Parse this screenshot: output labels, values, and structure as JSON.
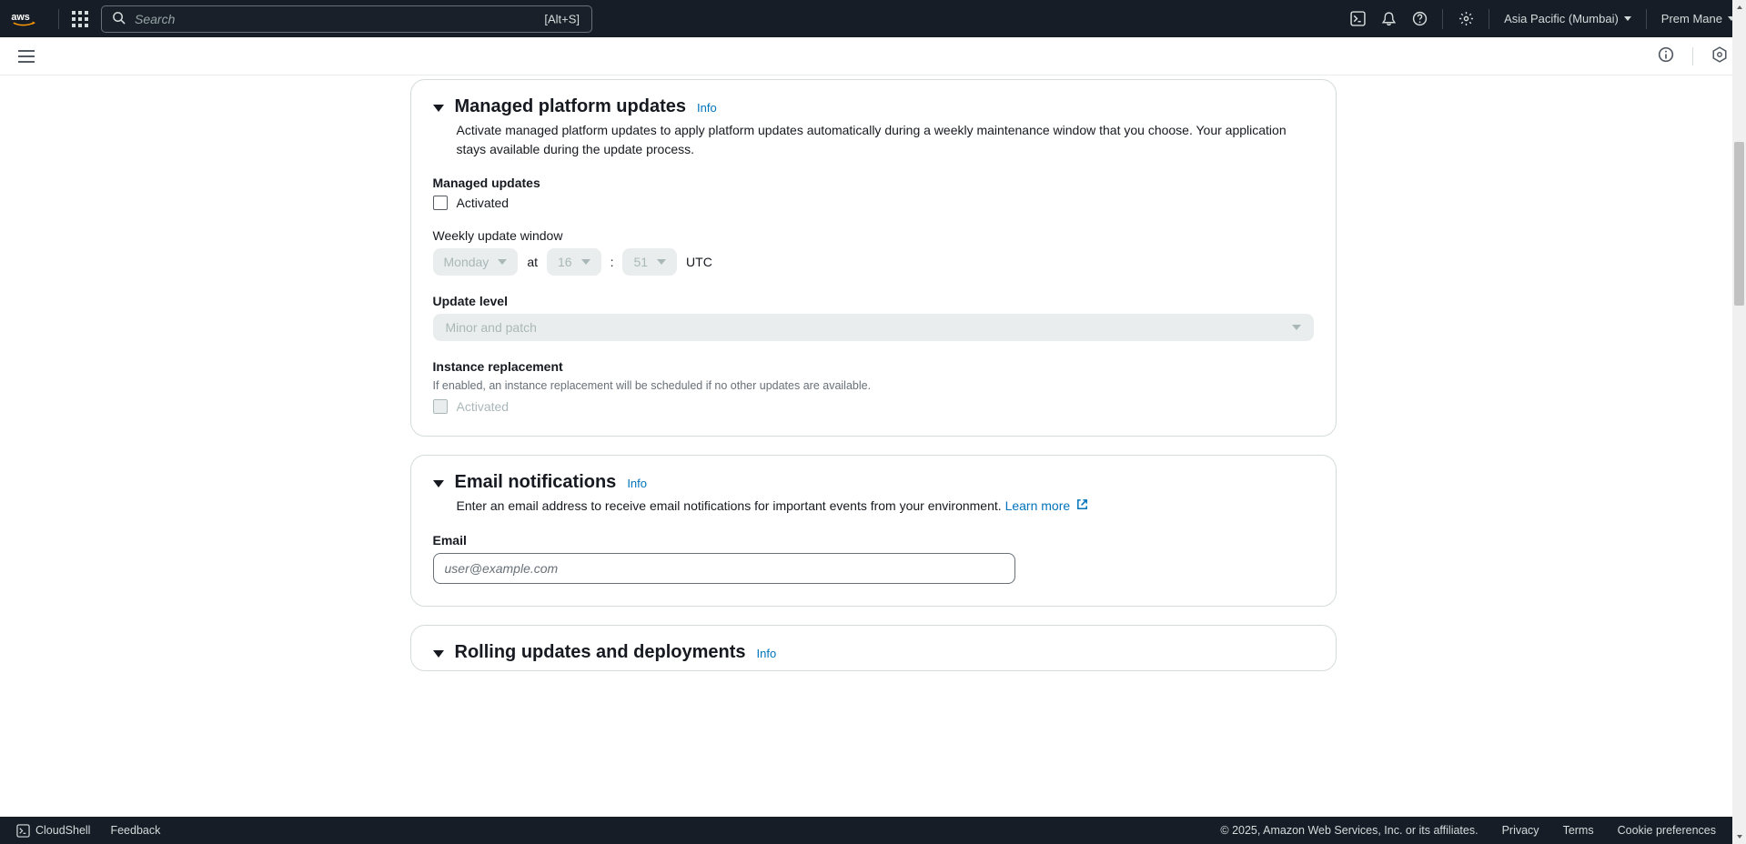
{
  "header": {
    "search_placeholder": "Search",
    "search_shortcut": "[Alt+S]",
    "region": "Asia Pacific (Mumbai)",
    "user": "Prem Mane"
  },
  "panels": {
    "managed_updates": {
      "title": "Managed platform updates",
      "info": "Info",
      "desc": "Activate managed platform updates to apply platform updates automatically during a weekly maintenance window that you choose. Your application stays available during the update process.",
      "managed_updates_label": "Managed updates",
      "activated_label": "Activated",
      "weekly_window_label": "Weekly update window",
      "day": "Monday",
      "at": "at",
      "hour": "16",
      "colon": ":",
      "minute": "51",
      "utc": "UTC",
      "update_level_label": "Update level",
      "update_level_value": "Minor and patch",
      "instance_replacement_label": "Instance replacement",
      "instance_replacement_hint": "If enabled, an instance replacement will be scheduled if no other updates are available.",
      "instance_activated": "Activated"
    },
    "email": {
      "title": "Email notifications",
      "info": "Info",
      "desc": "Enter an email address to receive email notifications for important events from your environment. ",
      "learn_more": "Learn more",
      "email_label": "Email",
      "placeholder": "user@example.com"
    },
    "rolling": {
      "title": "Rolling updates and deployments",
      "info": "Info"
    }
  },
  "footer": {
    "cloudshell": "CloudShell",
    "feedback": "Feedback",
    "copyright": "© 2025, Amazon Web Services, Inc. or its affiliates.",
    "privacy": "Privacy",
    "terms": "Terms",
    "cookie": "Cookie preferences"
  }
}
